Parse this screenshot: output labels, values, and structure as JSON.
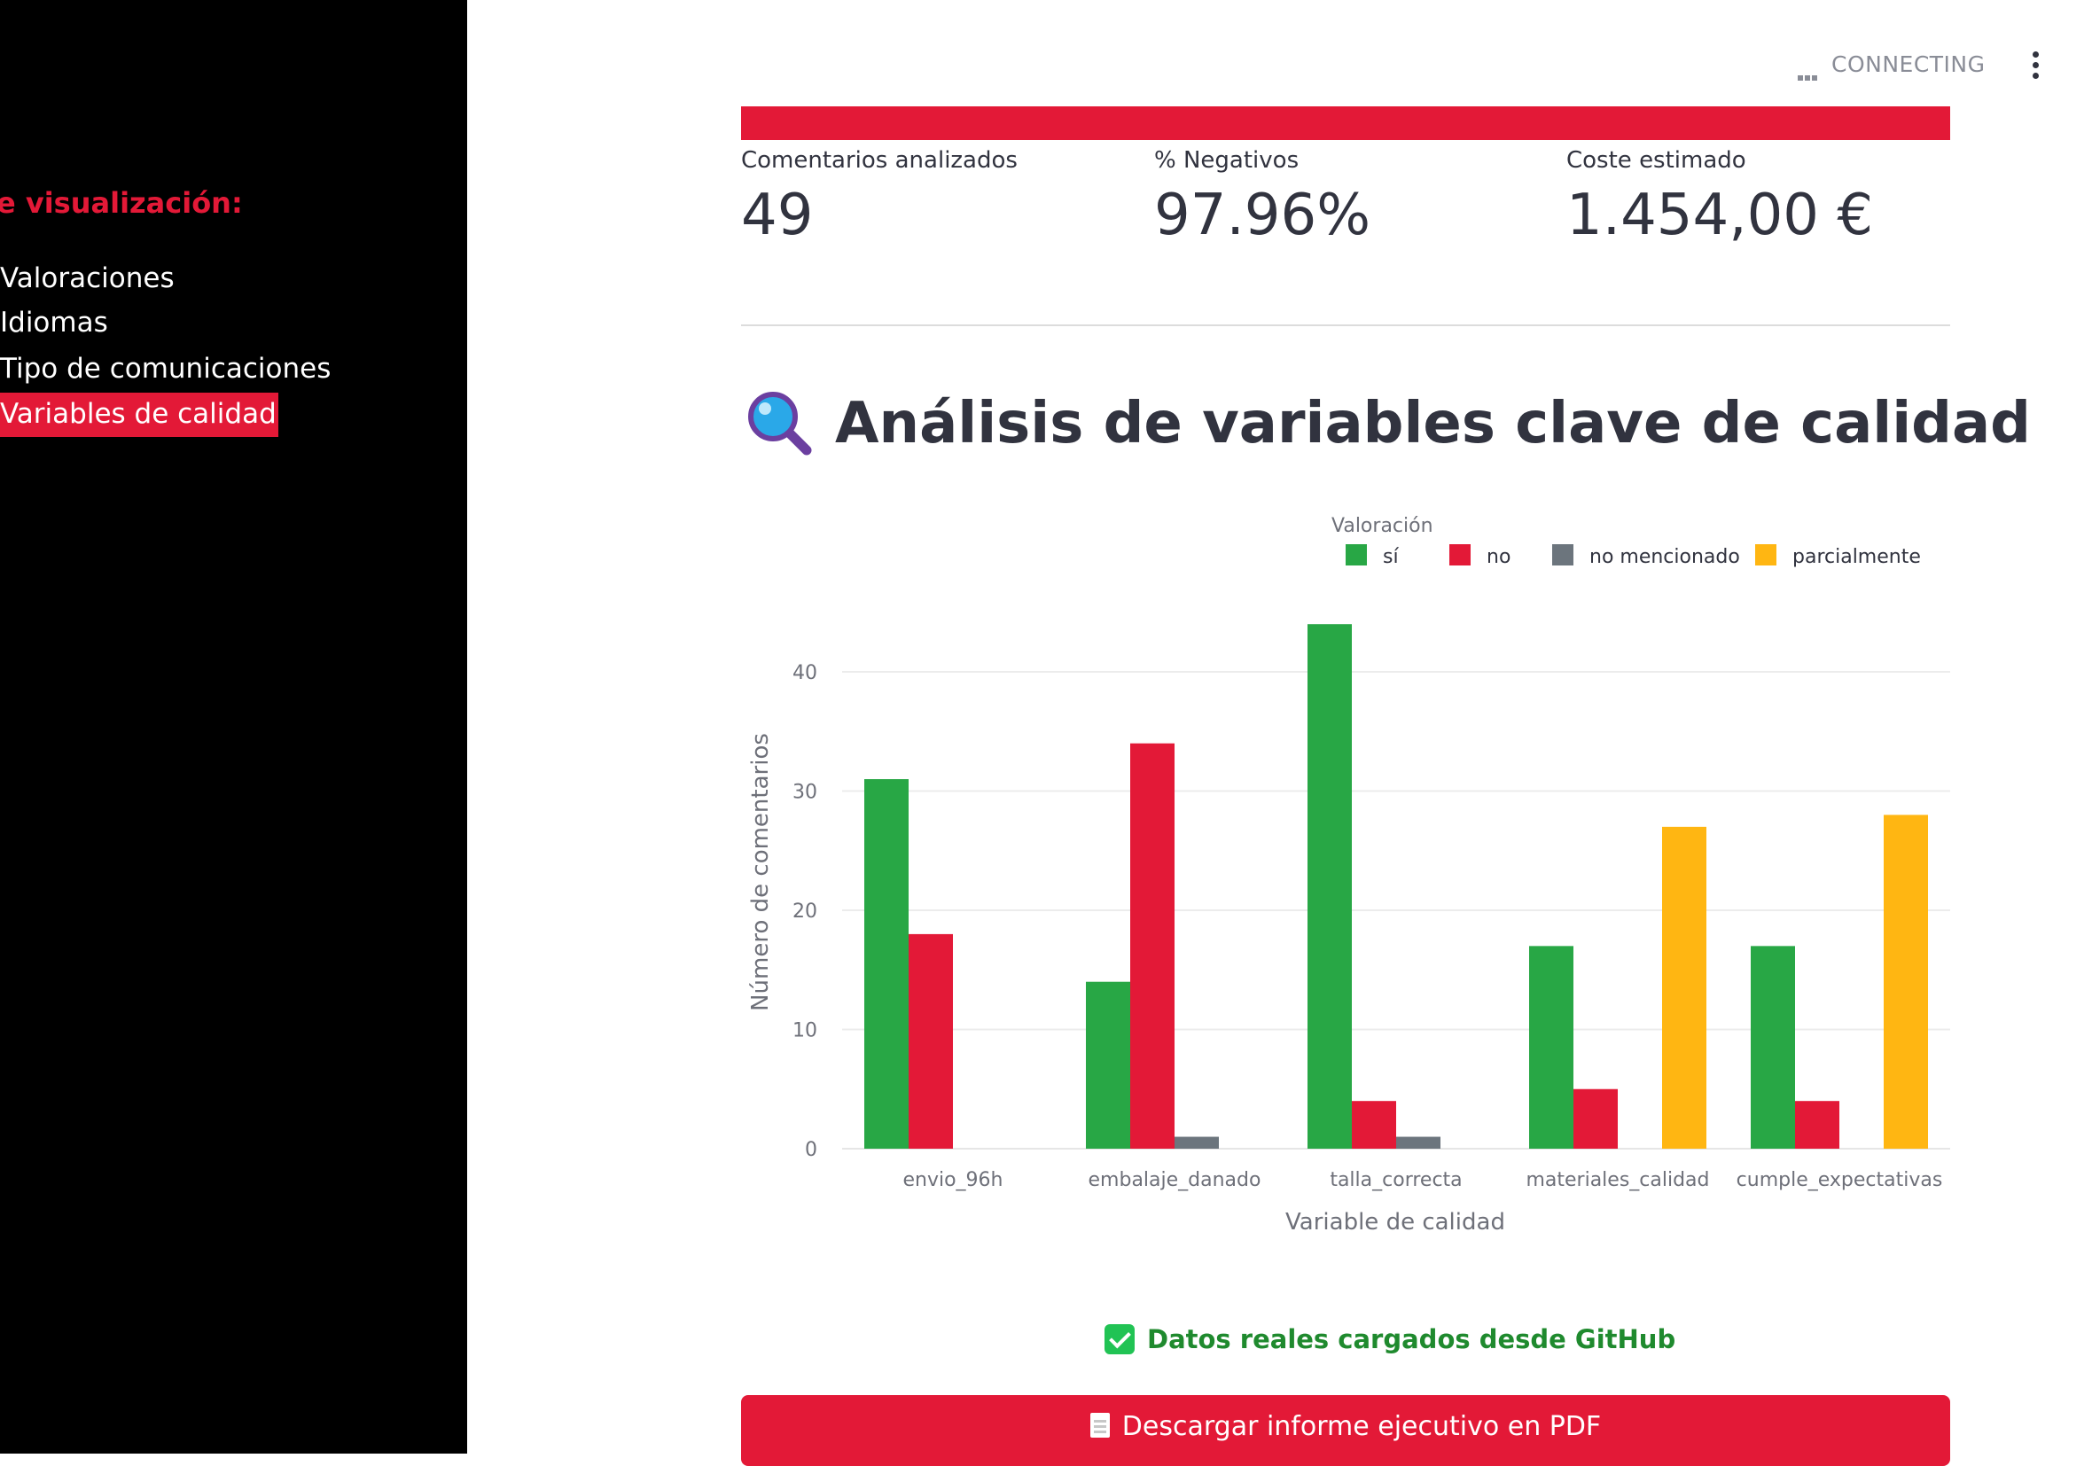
{
  "sidebar": {
    "title": "e visualización:",
    "items": [
      {
        "label": "Valoraciones",
        "active": false
      },
      {
        "label": "Idiomas",
        "active": false
      },
      {
        "label": "Tipo de comunicaciones",
        "active": false
      },
      {
        "label": "Variables de calidad",
        "active": true
      }
    ]
  },
  "topbar": {
    "status": "CONNECTING",
    "menu_icon": "kebab-menu-icon"
  },
  "metrics": [
    {
      "label": "Comentarios analizados",
      "value": "49"
    },
    {
      "label": "% Negativos",
      "value": "97.96%"
    },
    {
      "label": "Coste estimado",
      "value": "1.454,00 €"
    }
  ],
  "heading": {
    "icon": "magnifier-icon",
    "text": "Análisis de variables clave de calidad"
  },
  "chart_data": {
    "type": "bar",
    "title": "",
    "xlabel": "Variable de calidad",
    "ylabel": "Número de comentarios",
    "legend_title": "Valoración",
    "legend_position": "top-right",
    "grid": true,
    "ylim": [
      0,
      45
    ],
    "yticks": [
      0,
      10,
      20,
      30,
      40
    ],
    "categories": [
      "envio_96h",
      "embalaje_danado",
      "talla_correcta",
      "materiales_calidad",
      "cumple_expectativas"
    ],
    "series": [
      {
        "name": "sí",
        "color": "#28a745",
        "values": [
          31,
          14,
          44,
          17,
          17
        ]
      },
      {
        "name": "no",
        "color": "#e31937",
        "values": [
          18,
          34,
          4,
          5,
          4
        ]
      },
      {
        "name": "no mencionado",
        "color": "#6c757d",
        "values": [
          0,
          1,
          1,
          0,
          0
        ]
      },
      {
        "name": "parcialmente",
        "color": "#ffb612",
        "values": [
          0,
          0,
          0,
          27,
          28
        ]
      }
    ]
  },
  "success_message": "Datos reales cargados desde GitHub",
  "pdf_button": {
    "label": "Descargar informe ejecutivo en PDF",
    "icon": "document-icon"
  }
}
